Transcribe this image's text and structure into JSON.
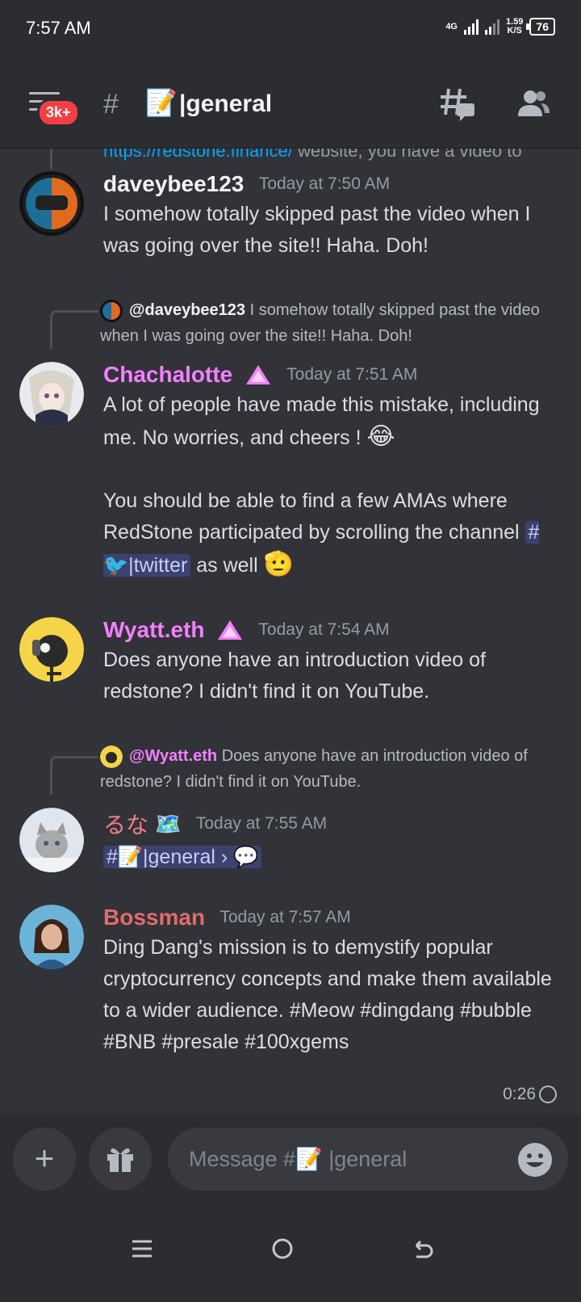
{
  "status": {
    "time": "7:57 AM",
    "network": "4G",
    "speed": "1.59",
    "speed_unit": "K/S",
    "battery": "76"
  },
  "header": {
    "badge": "3k+",
    "hash": "#",
    "channel_emoji": "📝",
    "channel_name": "|general"
  },
  "feed": {
    "prev": {
      "url": "https://redstone.finance/",
      "rest": " website, you have a video to"
    },
    "messages": [
      {
        "author": "daveybee123",
        "time": "Today at 7:50 AM",
        "text": "I somehow totally skipped past the video when I was going over the site!! Haha. Doh!"
      },
      {
        "reply_to": "@daveybee123",
        "reply_text": " I somehow totally skipped past the video when I was going over the site!! Haha. Doh!",
        "author": "Chachalotte",
        "time": "Today at 7:51 AM",
        "text1": "A lot of people have made this mistake, including me. No worries, and cheers ! ",
        "emoji1": "😂",
        "text2": "You should be able to find a few AMAs where RedStone participated by scrolling the channel ",
        "chip": "#🐦|twitter",
        "text3": " as well ",
        "emoji2": "🫡"
      },
      {
        "author": "Wyatt.eth",
        "time": "Today at 7:54 AM",
        "text": "Does anyone have an introduction video of redstone? I didn't find it on YouTube."
      },
      {
        "reply_to": "@Wyatt.eth",
        "reply_text": " Does anyone have an introduction video of redstone? I didn't find it on YouTube.",
        "author": "るな",
        "flag": "🗺️",
        "time": "Today at 7:55 AM",
        "chip": "#📝|general › 💬"
      },
      {
        "author": "Bossman",
        "time": "Today at 7:57 AM",
        "text": "Ding Dang's mission is to demystify popular cryptocurrency concepts and make them available to a wider audience. #Meow #dingdang #bubble #BNB #presale #100xgems"
      }
    ]
  },
  "footer": {
    "slowmode": "0:26",
    "placeholder": "Message #📝 |general"
  },
  "colors": {
    "chachalotte": "#f47fff",
    "wyatt": "#f47fff",
    "runa": "#f47b8a",
    "bossman": "#e06c6c",
    "accent": "#5865f2"
  }
}
